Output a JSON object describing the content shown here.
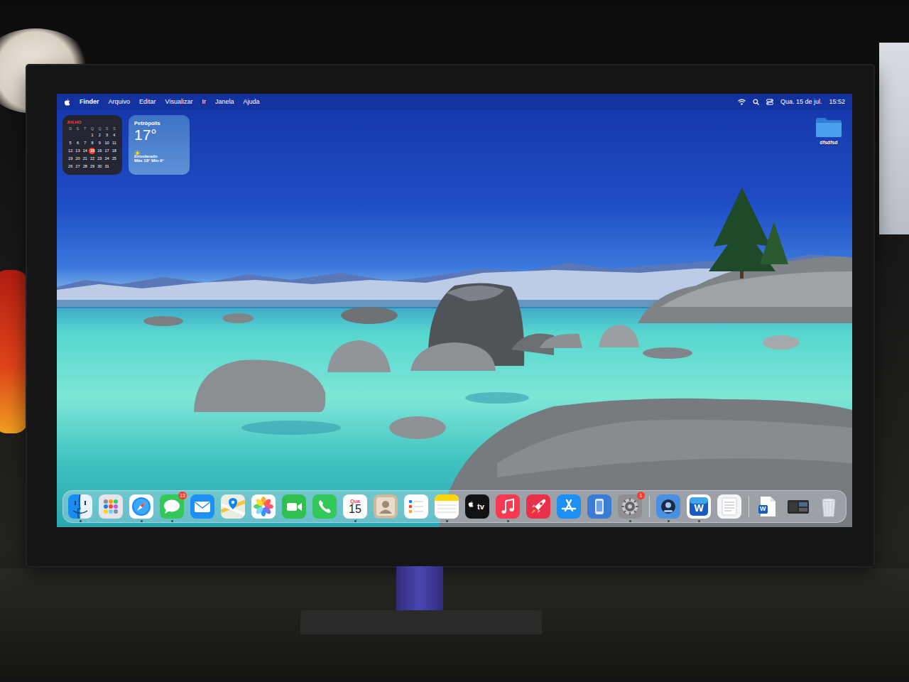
{
  "menu_bar": {
    "app": "Finder",
    "items": [
      "Arquivo",
      "Editar",
      "Visualizar",
      "Ir",
      "Janela",
      "Ajuda"
    ],
    "date": "Qua. 15 de jul.",
    "time": "15:52"
  },
  "widgets": {
    "calendar": {
      "month": "JULHO",
      "weekdays": [
        "D",
        "S",
        "T",
        "Q",
        "Q",
        "S",
        "S"
      ],
      "weeks": [
        [
          {
            "day": "1",
            "selected": false
          },
          {
            "day": "2",
            "selected": false
          },
          {
            "day": "3",
            "selected": false
          },
          {
            "day": "4",
            "selected": false
          }
        ],
        [
          {
            "day": "5",
            "selected": false
          },
          {
            "day": "6",
            "selected": false
          },
          {
            "day": "7",
            "selected": false
          },
          {
            "day": "8",
            "selected": false
          },
          {
            "day": "9",
            "selected": false
          },
          {
            "day": "10",
            "selected": false
          },
          {
            "day": "11",
            "selected": false
          }
        ],
        [
          {
            "day": "12",
            "selected": false
          },
          {
            "day": "13",
            "selected": false
          },
          {
            "day": "14",
            "selected": false
          },
          {
            "day": "15",
            "selected": true
          },
          {
            "day": "16",
            "selected": false
          },
          {
            "day": "17",
            "selected": false
          },
          {
            "day": "18",
            "selected": false
          }
        ],
        [
          {
            "day": "19",
            "selected": false
          },
          {
            "day": "20",
            "selected": false
          },
          {
            "day": "21",
            "selected": false
          },
          {
            "day": "22",
            "selected": false
          },
          {
            "day": "23",
            "selected": false
          },
          {
            "day": "24",
            "selected": false
          },
          {
            "day": "25",
            "selected": false
          }
        ],
        [
          {
            "day": "26",
            "selected": false
          },
          {
            "day": "27",
            "selected": false
          },
          {
            "day": "28",
            "selected": false
          },
          {
            "day": "29",
            "selected": false
          },
          {
            "day": "30",
            "selected": false
          },
          {
            "day": "31",
            "selected": false
          }
        ]
      ]
    },
    "weather": {
      "city": "Petrópolis",
      "temperature": "17°",
      "condition": "Ensolarado",
      "range": "Máx 18° Mín 9°"
    }
  },
  "desktop_icons": [
    {
      "label": "dfsdfsd"
    }
  ],
  "dock": {
    "items": [
      {
        "kind": "finder",
        "running": true
      },
      {
        "kind": "launchpad",
        "running": false
      },
      {
        "kind": "safari",
        "running": true
      },
      {
        "kind": "messages",
        "running": true,
        "badge": "13"
      },
      {
        "kind": "mail",
        "running": false
      },
      {
        "kind": "maps",
        "running": false
      },
      {
        "kind": "photos",
        "running": false
      },
      {
        "kind": "facetime",
        "running": false
      },
      {
        "kind": "phone",
        "running": false
      },
      {
        "kind": "calendar",
        "running": true,
        "texts": [
          "Qua",
          "15"
        ]
      },
      {
        "kind": "contacts",
        "running": false
      },
      {
        "kind": "reminders",
        "running": false
      },
      {
        "kind": "notes",
        "running": true
      },
      {
        "kind": "tv",
        "running": false,
        "texts": [
          "tv"
        ]
      },
      {
        "kind": "music",
        "running": true
      },
      {
        "kind": "rocket",
        "running": false
      },
      {
        "kind": "appstore",
        "running": false
      },
      {
        "kind": "mirroring",
        "running": false
      },
      {
        "kind": "settings",
        "running": true,
        "badge": "1"
      },
      {
        "kind": "separator",
        "running": false
      },
      {
        "kind": "utility",
        "running": true
      },
      {
        "kind": "word",
        "running": true,
        "texts": [
          "W"
        ]
      },
      {
        "kind": "pages",
        "running": false
      },
      {
        "kind": "separator",
        "running": false
      },
      {
        "kind": "document",
        "running": false,
        "texts": [
          "W"
        ]
      },
      {
        "kind": "screenshot",
        "running": false
      },
      {
        "kind": "trash",
        "running": false
      }
    ]
  }
}
